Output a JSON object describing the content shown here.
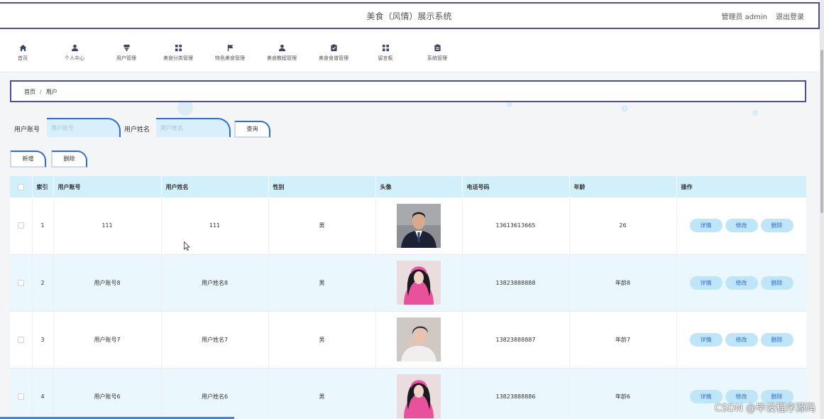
{
  "header": {
    "title": "美食（风情）展示系统",
    "admin": "管理员 admin",
    "logout": "退出登录"
  },
  "nav": [
    {
      "label": "首页",
      "icon": "home-icon"
    },
    {
      "label": "个人中心",
      "icon": "user-icon"
    },
    {
      "label": "用户管理",
      "icon": "users-icon"
    },
    {
      "label": "美食分类管理",
      "icon": "grid-icon"
    },
    {
      "label": "特色美食管理",
      "icon": "flag-icon"
    },
    {
      "label": "美食教程管理",
      "icon": "user-icon"
    },
    {
      "label": "美食食谱管理",
      "icon": "clipboard-icon"
    },
    {
      "label": "留言板",
      "icon": "grid-icon"
    },
    {
      "label": "系统管理",
      "icon": "clipboard-icon"
    }
  ],
  "breadcrumb": {
    "home": "首页",
    "sep": "/",
    "current": "用户"
  },
  "search": {
    "account_label": "用户账号",
    "account_placeholder": "用户账号",
    "name_label": "用户姓名",
    "name_placeholder": "用户姓名",
    "query_button": "查询"
  },
  "actions": {
    "add": "新增",
    "delete": "删除"
  },
  "table": {
    "headers": [
      "",
      "索引",
      "用户账号",
      "用户姓名",
      "性别",
      "头像",
      "电话号码",
      "年龄",
      "操作"
    ],
    "rows": [
      {
        "index": "1",
        "account": "111",
        "name": "111",
        "gender": "男",
        "avatar": "avatar-man-suit",
        "phone": "13613613665",
        "age": "26"
      },
      {
        "index": "2",
        "account": "用户账号8",
        "name": "用户姓名8",
        "gender": "男",
        "avatar": "avatar-girl-pink",
        "phone": "13823888888",
        "age": "年龄8"
      },
      {
        "index": "3",
        "account": "用户账号7",
        "name": "用户姓名7",
        "gender": "男",
        "avatar": "avatar-boy",
        "phone": "13823888887",
        "age": "年龄7"
      },
      {
        "index": "4",
        "account": "用户账号6",
        "name": "用户姓名6",
        "gender": "男",
        "avatar": "avatar-girl-pink",
        "phone": "13823888886",
        "age": "年龄6"
      }
    ],
    "row_actions": {
      "detail": "详情",
      "edit": "修改",
      "delete": "删除"
    }
  },
  "watermark": "CSDN @毕设程序源码",
  "colors": {
    "accent": "#2f6ad6",
    "header_border": "#4a4f9c",
    "table_header": "#d2f0fb",
    "row_alt": "#eaf7fc"
  }
}
